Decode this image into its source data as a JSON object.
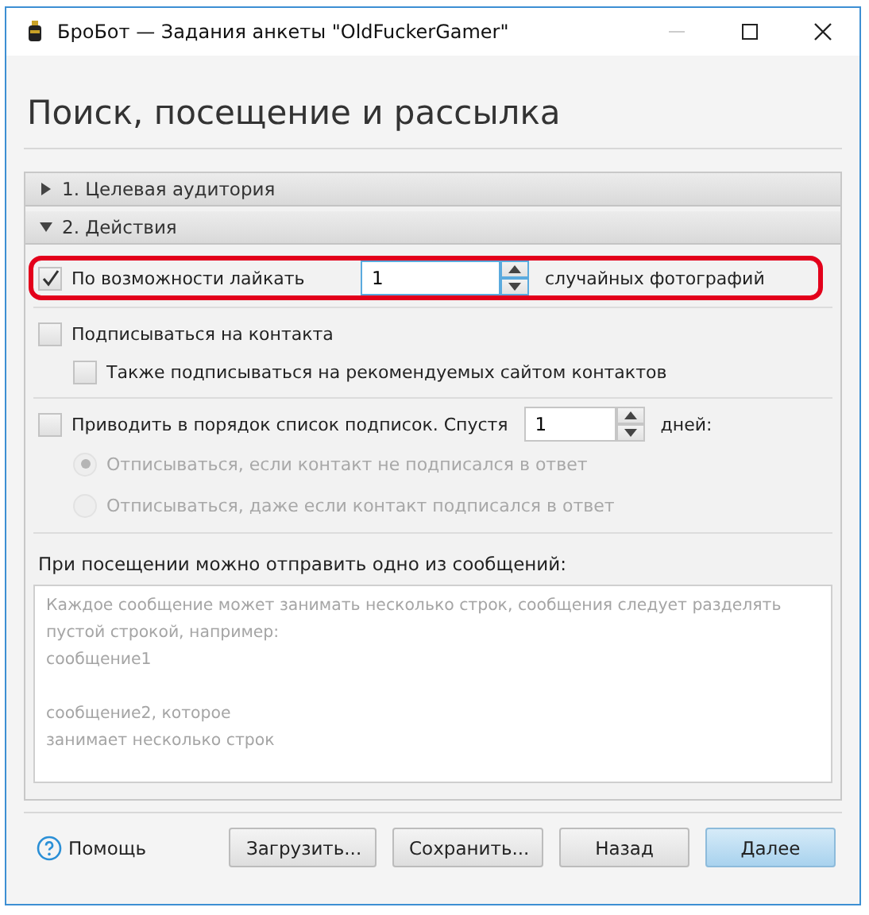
{
  "window": {
    "title": "БроБот — Задания анкеты \"OldFuckerGamer\""
  },
  "heading": "Поиск, посещение и рассылка",
  "sections": [
    {
      "label": "1. Целевая аудитория",
      "expanded": false
    },
    {
      "label": "2. Действия",
      "expanded": true
    }
  ],
  "like_photos": {
    "checked": true,
    "highlighted": true,
    "label": "По возможности лайкать",
    "value": "1",
    "suffix": "случайных фотографий"
  },
  "subscribe": {
    "checked": false,
    "label": "Подписываться на контакта"
  },
  "also_subscribe": {
    "checked": false,
    "label": "Также подписываться на рекомендуемых сайтом контактов"
  },
  "cleanup": {
    "checked": false,
    "label": "Приводить в порядок список подписок. Спустя",
    "value": "1",
    "suffix": "дней:"
  },
  "unsubscribe_options": [
    {
      "label": "Отписываться, если контакт не подписался в ответ",
      "selected": true,
      "disabled": true
    },
    {
      "label": "Отписываться, даже если контакт подписался в ответ",
      "selected": false,
      "disabled": true
    }
  ],
  "messages": {
    "label": "При посещении можно отправить одно из сообщений:",
    "placeholder": "Каждое сообщение может занимать несколько строк, сообщения следует разделять\nпустой строкой, например:\nсообщение1\n\nсообщение2, которое\nзанимает несколько строк"
  },
  "footer": {
    "help": "Помощь",
    "buttons": [
      {
        "label": "Загрузить...",
        "default": false
      },
      {
        "label": "Сохранить...",
        "default": false
      },
      {
        "label": "Назад",
        "default": false
      },
      {
        "label": "Далее",
        "default": true
      }
    ]
  }
}
